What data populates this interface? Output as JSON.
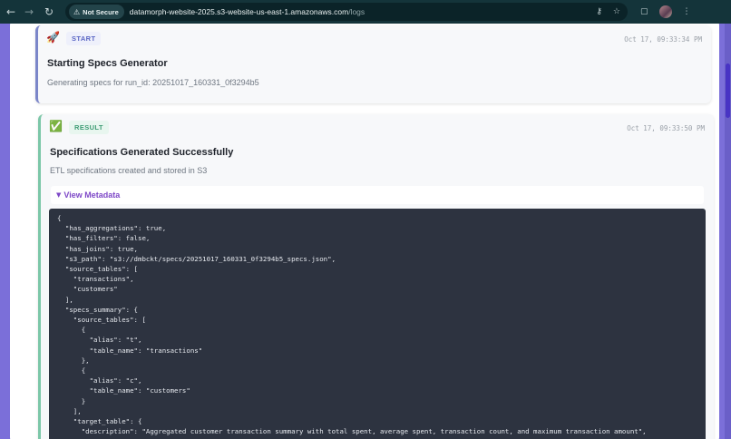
{
  "browser": {
    "security_label": "Not Secure",
    "url_host": "datamorph-website-2025.s3-website-us-east-1.amazonaws.com",
    "url_path": "/logs"
  },
  "logs": {
    "start": {
      "emoji": "🚀",
      "badge": "START",
      "timestamp": "Oct 17, 09:33:34 PM",
      "title": "Starting Specs Generator",
      "subtitle": "Generating specs for run_id: 20251017_160331_0f3294b5"
    },
    "result": {
      "emoji": "✅",
      "badge": "RESULT",
      "timestamp": "Oct 17, 09:33:50 PM",
      "title": "Specifications Generated Successfully",
      "subtitle": "ETL specifications created and stored in S3",
      "metadata_toggle": "View Metadata",
      "code_lines": [
        "{",
        "  \"has_aggregations\": true,",
        "  \"has_filters\": false,",
        "  \"has_joins\": true,",
        "  \"s3_path\": \"s3://dmbckt/specs/20251017_160331_0f3294b5_specs.json\",",
        "  \"source_tables\": [",
        "    \"transactions\",",
        "    \"customers\"",
        "  ],",
        "  \"specs_summary\": {",
        "    \"source_tables\": [",
        "      {",
        "        \"alias\": \"t\",",
        "        \"table_name\": \"transactions\"",
        "      },",
        "      {",
        "        \"alias\": \"c\",",
        "        \"table_name\": \"customers\"",
        "      }",
        "    ],",
        "    \"target_table\": {",
        "      \"description\": \"Aggregated customer transaction summary with total spent, average spent, transaction count, and maximum transaction amount\","
      ]
    }
  },
  "colors": {
    "accent_purple": "#7d47c7",
    "start_border": "#7b86c9",
    "result_border": "#7cc7a8",
    "code_bg": "#2d3340",
    "page_bg": "#7b6fd9"
  }
}
